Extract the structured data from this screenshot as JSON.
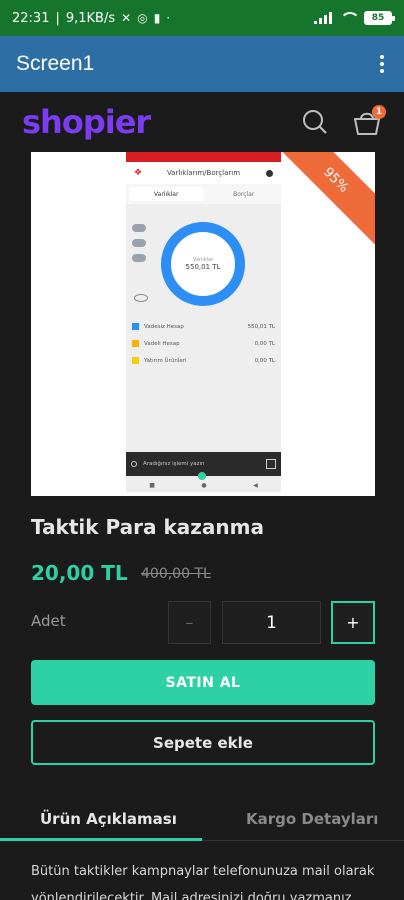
{
  "status_bar": {
    "time": "22:31",
    "net_speed": "9,1KB/s",
    "battery": "85"
  },
  "app_bar": {
    "title": "Screen1"
  },
  "shop": {
    "logo_text": "shopier",
    "cart_count": "1",
    "icons": [
      "search-icon",
      "cart-icon",
      "kebab-menu-icon"
    ],
    "brand_color": "#7b3cf2",
    "accent_color": "#2ed1a3"
  },
  "product": {
    "discount_badge": "95%",
    "title": "Taktik Para kazanma",
    "price": "20,00 TL",
    "old_price": "400,00 TL",
    "quantity_label": "Adet",
    "quantity_value": "1",
    "minus_label": "–",
    "plus_label": "+",
    "buy_button": "SATIN AL",
    "add_to_cart_button": "Sepete ekle"
  },
  "screenshot_preview": {
    "header": "Varlıklarım/Borçlarım",
    "tab_assets": "Varlıklar",
    "tab_debts": "Borçlar",
    "donut_label": "Varlıklar",
    "donut_value": "550,01 TL",
    "rows": [
      {
        "label": "Vadesiz Hesap",
        "amount": "550,01 TL",
        "color": "#2d8ef5"
      },
      {
        "label": "Vadeli Hesap",
        "amount": "0,00 TL",
        "color": "#f5b400"
      },
      {
        "label": "Yatırım Ürünleri",
        "amount": "0,00 TL",
        "color": "#f5d000"
      }
    ],
    "search_placeholder": "Aradığınız işlemi yazın",
    "nav": [
      "■",
      "●",
      "◀"
    ]
  },
  "tabs": {
    "description": "Ürün Açıklaması",
    "shipping": "Kargo Detayları"
  },
  "description_text": "Bütün taktikler kampnaylar telefonunuza mail olarak yönlendirilecektir. Mail adresinizi doğru yazmanız"
}
